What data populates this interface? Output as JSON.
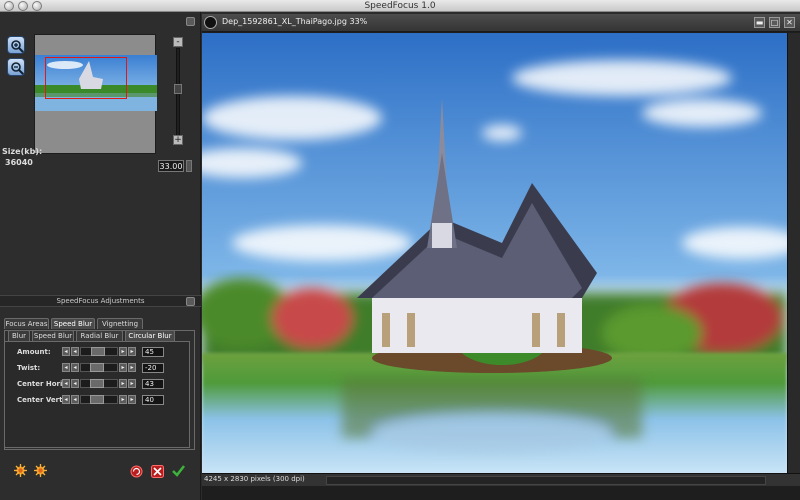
{
  "app": {
    "title": "SpeedFocus 1.0"
  },
  "navigator": {
    "size_label": "Size(kb):",
    "size_value": "36040",
    "zoom_value": "33.00",
    "minus_label": "-",
    "plus_label": "+"
  },
  "adjustments": {
    "title": "SpeedFocus Adjustments",
    "tabs": [
      {
        "label": "Focus Areas",
        "active": false
      },
      {
        "label": "Speed Blur",
        "active": true
      },
      {
        "label": "Vignetting",
        "active": false
      }
    ],
    "subtabs": [
      {
        "label": "Blur",
        "active": false
      },
      {
        "label": "Speed Blur",
        "active": false
      },
      {
        "label": "Radial Blur",
        "active": false
      },
      {
        "label": "Circular Blur",
        "active": true
      }
    ],
    "params": [
      {
        "label": "Amount:",
        "value": "45",
        "level": 0.45
      },
      {
        "label": "Twist:",
        "value": "-20",
        "level": 0.4
      },
      {
        "label": "Center Horiz:",
        "value": "43",
        "level": 0.43
      },
      {
        "label": "Center Vert:",
        "value": "40",
        "level": 0.4
      }
    ]
  },
  "document": {
    "title": "Dep_1592861_XL_ThaiPago.jpg 33%",
    "status": "4245 x 2830 pixels (300 dpi)"
  },
  "icons": {
    "zoom_in": "zoom-in-icon",
    "zoom_out": "zoom-out-icon",
    "orange_gear_1": "sun-gear-icon",
    "orange_gear_2": "sun-gear-icon",
    "reset": "reset-icon",
    "cancel": "cancel-icon",
    "apply": "checkmark-icon"
  },
  "colors": {
    "accent_red": "#e01818",
    "apply_green": "#3cb43c",
    "zoom_blue": "#4f86c9"
  }
}
